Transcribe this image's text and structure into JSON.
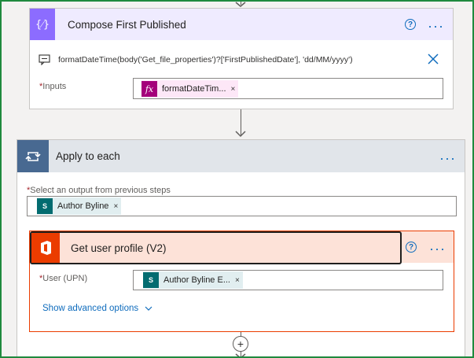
{
  "compose": {
    "title": "Compose First Published",
    "expression": "formatDateTime(body('Get_file_properties')?['FirstPublishedDate'], 'dd/MM/yyyy')",
    "inputs_label": "Inputs",
    "inputs_token": "formatDateTim...",
    "icon": "curly-braces-icon",
    "color": "#8c6cff"
  },
  "apply_each": {
    "title": "Apply to each",
    "select_label": "Select an output from previous steps",
    "select_token": "Author Byline",
    "icon": "loop-icon",
    "color": "#486991"
  },
  "get_user": {
    "title": "Get user profile (V2)",
    "user_label": "User (UPN)",
    "user_token": "Author Byline E...",
    "advanced_label": "Show advanced options",
    "icon": "office-icon",
    "color": "#eb3c00"
  },
  "required_marker": "*",
  "more_glyph": "···",
  "help_glyph": "?",
  "remove_glyph": "×",
  "add_glyph": "+"
}
